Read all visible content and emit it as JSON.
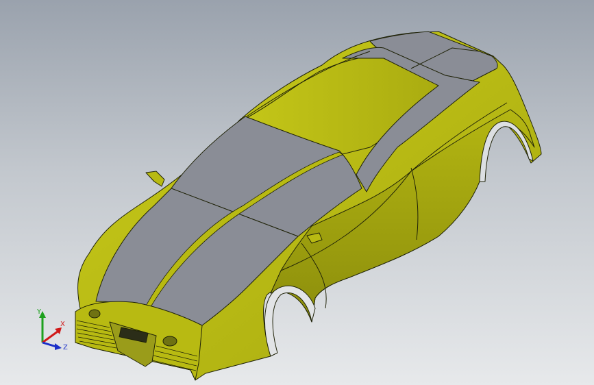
{
  "viewport": {
    "model_name": "sports-car-body",
    "body_color": "#b8ba12",
    "body_shade": "#8e9010",
    "stripe_color": "#8a8d96",
    "edge_color": "#1f2208"
  },
  "triad": {
    "x_label": "X",
    "y_label": "Y",
    "z_label": "Z",
    "x_color": "#d01818",
    "y_color": "#1ea01e",
    "z_color": "#1a2fc8"
  }
}
